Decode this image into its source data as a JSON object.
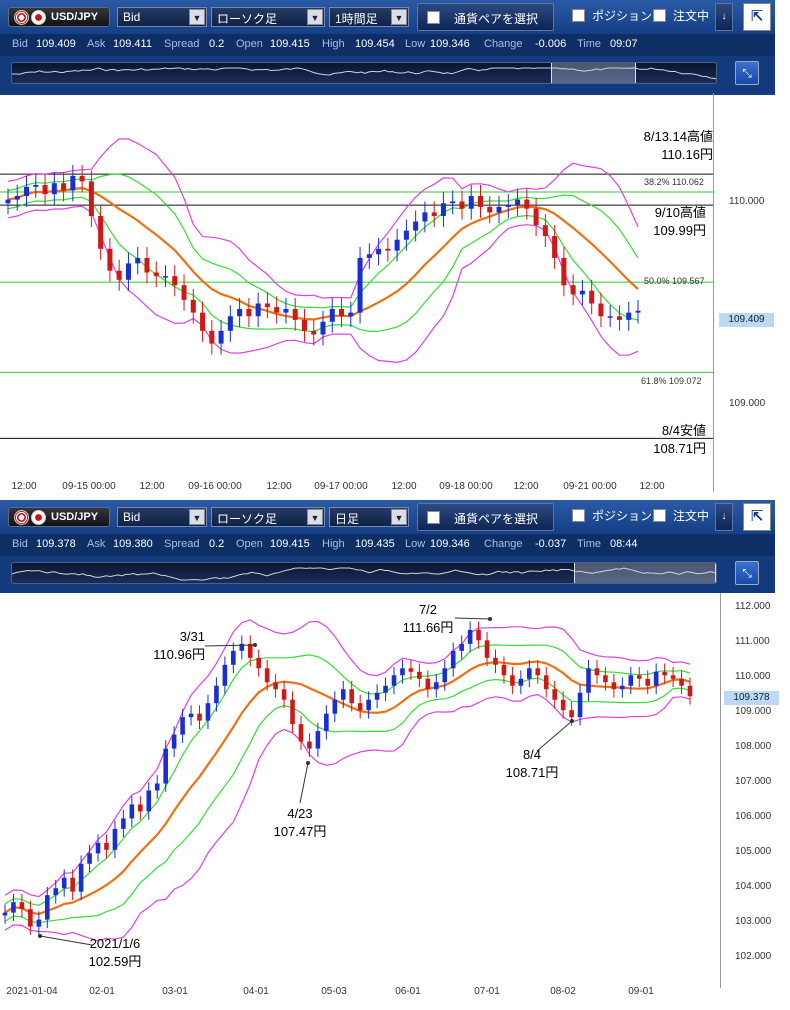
{
  "charts": [
    {
      "toolbar": {
        "pair": "USD/JPY",
        "price_type": "Bid",
        "chart_style": "ローソク足",
        "timeframe": "1時間足",
        "pair_select_label": "通貨ペアを選択",
        "position_label": "ポジション",
        "order_label": "注文中",
        "side_button": "↓",
        "expand_icon": "⇱"
      },
      "quote": {
        "bid_label": "Bid",
        "bid": "109.409",
        "ask_label": "Ask",
        "ask": "109.411",
        "spread_label": "Spread",
        "spread": "0.2",
        "open_label": "Open",
        "open": "109.415",
        "high_label": "High",
        "high": "109.454",
        "low_label": "Low",
        "low": "109.346",
        "change_label": "Change",
        "change": "-0.006",
        "time_label": "Time",
        "time": "09:07"
      },
      "y_ticks": [
        "110.000",
        "109.000"
      ],
      "last_price": "109.409",
      "x_ticks": [
        "12:00",
        "09-15 00:00",
        "12:00",
        "09-16 00:00",
        "12:00",
        "09-17 00:00",
        "12:00",
        "09-18 00:00",
        "12:00",
        "09-21 00:00",
        "12:00"
      ],
      "fib_labels": [
        "38.2%  110.062",
        "50.0%  109.567",
        "61.8%  109.072"
      ],
      "annotations": [
        {
          "line1": "8/13.14高値",
          "line2": "110.16円"
        },
        {
          "line1": "9/10高値",
          "line2": "109.99円"
        },
        {
          "line1": "8/4安値",
          "line2": "108.71円"
        }
      ]
    },
    {
      "toolbar": {
        "pair": "USD/JPY",
        "price_type": "Bid",
        "chart_style": "ローソク足",
        "timeframe": "日足",
        "pair_select_label": "通貨ペアを選択",
        "position_label": "ポジション",
        "order_label": "注文中",
        "side_button": "↓",
        "expand_icon": "⇱"
      },
      "quote": {
        "bid_label": "Bid",
        "bid": "109.378",
        "ask_label": "Ask",
        "ask": "109.380",
        "spread_label": "Spread",
        "spread": "0.2",
        "open_label": "Open",
        "open": "109.415",
        "high_label": "High",
        "high": "109.435",
        "low_label": "Low",
        "low": "109.346",
        "change_label": "Change",
        "change": "-0.037",
        "time_label": "Time",
        "time": "08:44"
      },
      "y_ticks": [
        "112.000",
        "111.000",
        "110.000",
        "109.000",
        "108.000",
        "107.000",
        "106.000",
        "105.000",
        "104.000",
        "103.000",
        "102.000"
      ],
      "last_price": "109.378",
      "x_ticks": [
        "2021-01-04",
        "02-01",
        "03-01",
        "04-01",
        "05-03",
        "06-01",
        "07-01",
        "08-02",
        "09-01"
      ],
      "annotations": [
        {
          "line1": "3/31",
          "line2": "110.96円"
        },
        {
          "line1": "7/2",
          "line2": "111.66円"
        },
        {
          "line1": "4/23",
          "line2": "107.47円"
        },
        {
          "line1": "8/4",
          "line2": "108.71円"
        },
        {
          "line1": "2021/1/6",
          "line2": "102.59円"
        }
      ]
    }
  ],
  "chart_data": [
    {
      "type": "candlestick",
      "title": "USD/JPY 1時間足",
      "ylim": [
        108.52,
        110.55
      ],
      "series": [
        {
          "name": "close",
          "values": [
            110.02,
            110.04,
            110.09,
            110.1,
            110.05,
            110.11,
            110.07,
            110.15,
            110.12,
            109.93,
            109.75,
            109.63,
            109.58,
            109.67,
            109.7,
            109.62,
            109.6,
            109.6,
            109.55,
            109.47,
            109.4,
            109.3,
            109.23,
            109.3,
            109.38,
            109.42,
            109.38,
            109.45,
            109.43,
            109.4,
            109.42,
            109.36,
            109.3,
            109.28,
            109.35,
            109.42,
            109.38,
            109.4,
            109.7,
            109.72,
            109.75,
            109.74,
            109.8,
            109.85,
            109.9,
            109.95,
            109.93,
            110.0,
            110.01,
            109.97,
            110.04,
            109.98,
            109.95,
            109.98,
            109.99,
            110.02,
            109.97,
            109.88,
            109.82,
            109.7,
            109.55,
            109.5,
            109.52,
            109.45,
            109.38,
            109.38,
            109.36,
            109.4,
            109.41
          ]
        }
      ],
      "horizontal_lines": [
        110.16,
        110.062,
        109.99,
        109.567,
        109.072,
        108.71
      ],
      "last": 109.409
    },
    {
      "type": "candlestick",
      "title": "USD/JPY 日足",
      "ylim": [
        101.7,
        112.3
      ],
      "series": [
        {
          "name": "close",
          "values": [
            103.2,
            103.5,
            103.3,
            102.8,
            103.0,
            103.7,
            103.9,
            104.2,
            103.8,
            104.6,
            104.9,
            105.2,
            105.0,
            105.6,
            105.9,
            106.3,
            106.1,
            106.7,
            106.9,
            107.9,
            108.3,
            108.8,
            108.9,
            108.7,
            109.2,
            109.7,
            110.3,
            110.7,
            110.9,
            110.5,
            110.2,
            109.8,
            109.6,
            109.3,
            108.6,
            108.1,
            107.9,
            108.4,
            108.9,
            109.3,
            109.6,
            109.2,
            109.0,
            109.3,
            109.5,
            109.7,
            110.0,
            110.2,
            110.1,
            109.9,
            109.6,
            109.8,
            110.2,
            110.7,
            110.9,
            111.3,
            111.0,
            110.5,
            110.3,
            110.0,
            109.7,
            109.9,
            110.2,
            110.0,
            109.6,
            109.3,
            109.0,
            108.8,
            109.5,
            110.2,
            110.0,
            109.8,
            109.6,
            109.7,
            110.0,
            109.9,
            109.7,
            110.1,
            110.0,
            109.9,
            109.7,
            109.4
          ]
        }
      ],
      "last": 109.378
    }
  ]
}
